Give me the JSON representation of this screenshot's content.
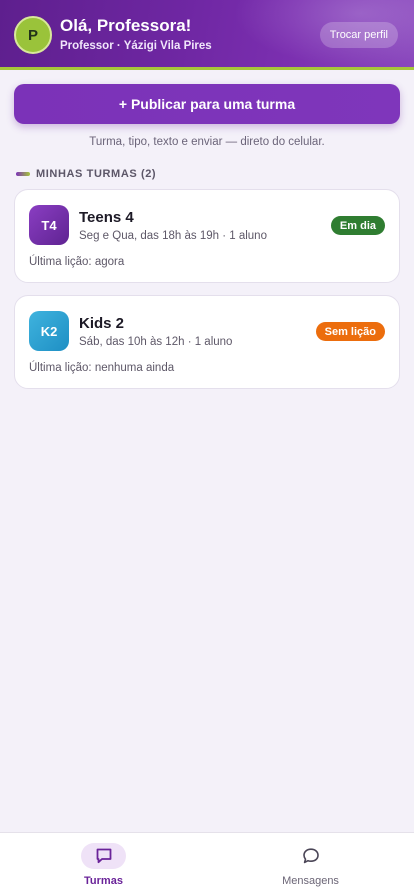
{
  "header": {
    "avatar_initial": "P",
    "greeting": "Olá, Professora!",
    "subtitle": "Professor · Yázigi Vila Pires",
    "switch_profile_label": "Trocar perfil"
  },
  "publish": {
    "button_label": "+ Publicar para uma turma",
    "hint": "Turma, tipo, texto e enviar — direto do celular."
  },
  "section": {
    "title": "MINHAS TURMAS (2)"
  },
  "classes": [
    {
      "code": "T4",
      "name": "Teens 4",
      "schedule": "Seg e Qua, das 18h às 19h · 1 aluno",
      "status": "Em dia",
      "status_color": "#2f7d31",
      "last_lesson": "Última lição: agora"
    },
    {
      "code": "K2",
      "name": "Kids 2",
      "schedule": "Sáb, das 10h às 12h · 1 aluno",
      "status": "Sem lição",
      "status_color": "#ec6d0d",
      "last_lesson": "Última lição: nenhuma ainda"
    }
  ],
  "bottom_nav": {
    "items": [
      {
        "label": "Turmas",
        "icon": "chat-square-icon",
        "active": true
      },
      {
        "label": "Mensagens",
        "icon": "chat-bubble-icon",
        "active": false
      }
    ]
  },
  "colors": {
    "brand_purple": "#6f27a3",
    "accent_green": "#a6c63a"
  }
}
